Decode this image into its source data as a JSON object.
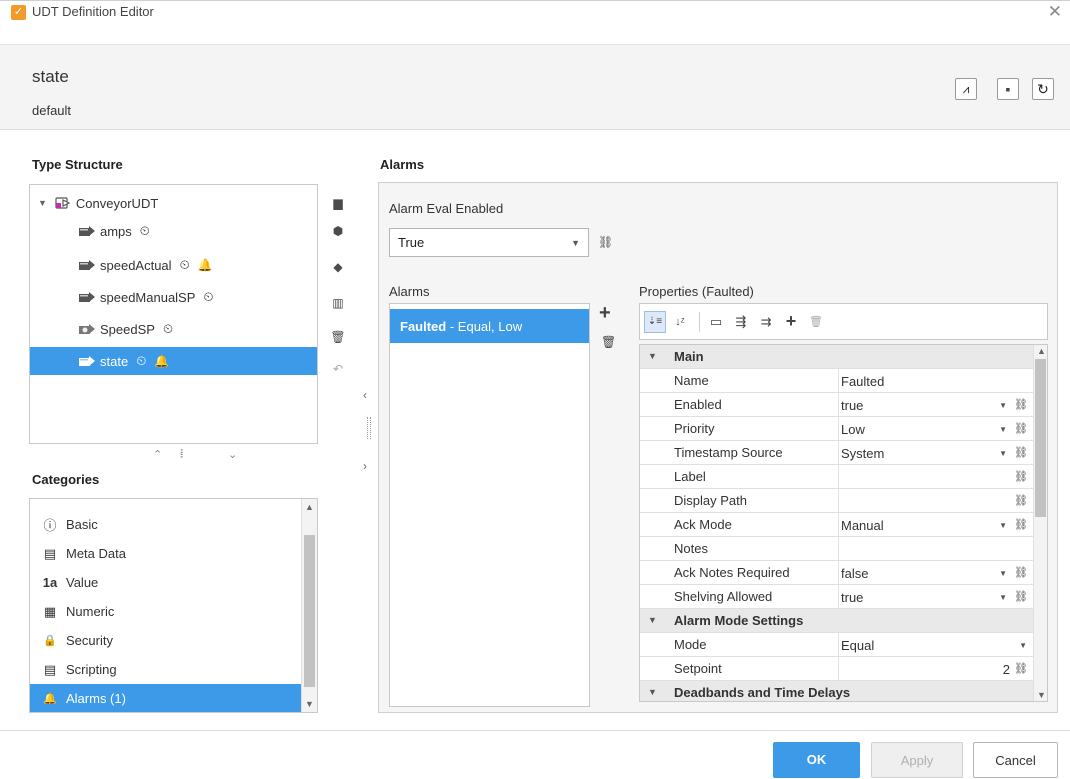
{
  "window": {
    "title": "UDT Definition Editor",
    "close_glyph": "✕",
    "app_icon": "udt-editor-icon",
    "app_icon_glyph": "✓"
  },
  "header": {
    "tag_name": "state",
    "provider": "default",
    "buttons": [
      {
        "name": "trend-button",
        "icon": "trend-icon",
        "glyph": "⩘"
      },
      {
        "name": "documentation-button",
        "icon": "note-icon",
        "glyph": "▪"
      },
      {
        "name": "refresh-button",
        "icon": "refresh-icon",
        "glyph": "↻"
      }
    ]
  },
  "type_structure": {
    "title": "Type Structure",
    "items": [
      {
        "label": "ConveyorUDT",
        "icon": "udt-instance-icon",
        "expander": "▼",
        "clock": false,
        "bell": false,
        "selected": false
      },
      {
        "label": "amps",
        "icon": "tag-icon",
        "clock": true,
        "bell": false,
        "selected": false
      },
      {
        "label": "speedActual",
        "icon": "tag-icon",
        "clock": true,
        "bell": true,
        "selected": false
      },
      {
        "label": "speedManualSP",
        "icon": "tag-icon",
        "clock": true,
        "bell": false,
        "selected": false
      },
      {
        "label": "SpeedSP",
        "icon": "memory-tag-icon",
        "clock": true,
        "bell": false,
        "selected": false
      },
      {
        "label": "state",
        "icon": "tag-icon",
        "clock": true,
        "bell": true,
        "selected": true
      }
    ],
    "clock_glyph": "⏲",
    "bell_glyph": "🔔",
    "tools": [
      {
        "name": "new-folder-button",
        "icon": "folder-icon",
        "glyph": "▆"
      },
      {
        "name": "new-tag-button",
        "icon": "add-tag-icon",
        "glyph": "⬢"
      },
      {
        "name": "new-udt-button",
        "icon": "tag-edit-icon",
        "glyph": "◆"
      },
      {
        "name": "data-types-button",
        "icon": "grid-icon",
        "glyph": "▥"
      },
      {
        "name": "delete-button",
        "icon": "trash-icon",
        "glyph": "🗑"
      },
      {
        "name": "revert-button",
        "icon": "revert-icon",
        "glyph": "↶"
      }
    ],
    "footer": {
      "up": "⌃",
      "grip": "⦙⦙⦙",
      "down": "⌄"
    }
  },
  "splitter": {
    "left": "‹",
    "right": "›"
  },
  "categories": {
    "title": "Categories",
    "items": [
      {
        "label": "Basic",
        "icon": "info-icon",
        "glyph": "ⓘ",
        "selected": false
      },
      {
        "label": "Meta Data",
        "icon": "database-icon",
        "glyph": "▤",
        "selected": false
      },
      {
        "label": "Value",
        "icon": "value-icon",
        "glyph": "1a",
        "selected": false
      },
      {
        "label": "Numeric",
        "icon": "calculator-icon",
        "glyph": "▦",
        "selected": false
      },
      {
        "label": "Security",
        "icon": "lock-icon",
        "glyph": "🔒",
        "selected": false
      },
      {
        "label": "Scripting",
        "icon": "script-icon",
        "glyph": "▤",
        "selected": false
      },
      {
        "label": "Alarms (1)",
        "icon": "bell-icon",
        "glyph": "🔔",
        "selected": true
      }
    ]
  },
  "alarms_section": {
    "title": "Alarms",
    "eval_label": "Alarm Eval Enabled",
    "eval_value": "True",
    "list_label": "Alarms",
    "add_glyph": "+",
    "delete_glyph": "🗑",
    "link_glyph": "⛓",
    "alarm": {
      "name": "Faulted",
      "desc": " - Equal, Low"
    },
    "properties_label": "Properties (Faulted)",
    "toolbar": [
      {
        "name": "sort-categorized-button",
        "icon": "sort-category-icon",
        "glyph": "⇣≡",
        "active": true
      },
      {
        "name": "sort-alpha-button",
        "icon": "sort-alpha-icon",
        "glyph": "↓ᶻ",
        "active": false
      },
      {
        "name": "property-pages-button",
        "icon": "property-pages-icon",
        "glyph": "▭",
        "active": false
      },
      {
        "name": "expand-all-button",
        "icon": "expand-all-icon",
        "glyph": "⇶",
        "active": false
      },
      {
        "name": "collapse-all-button",
        "icon": "collapse-all-icon",
        "glyph": "⇉",
        "active": false
      },
      {
        "name": "add-property-button",
        "icon": "plus-icon",
        "glyph": "+",
        "active": false
      },
      {
        "name": "remove-property-button",
        "icon": "trash-icon",
        "glyph": "🗑",
        "active": false
      }
    ],
    "grid": {
      "groups": [
        {
          "name": "Main",
          "rows": [
            {
              "name": "Name",
              "value": "Faulted",
              "dropdown": false,
              "link": false
            },
            {
              "name": "Enabled",
              "value": "true",
              "dropdown": true,
              "link": true
            },
            {
              "name": "Priority",
              "value": "Low",
              "dropdown": true,
              "link": true
            },
            {
              "name": "Timestamp Source",
              "value": "System",
              "dropdown": true,
              "link": true
            },
            {
              "name": "Label",
              "value": "",
              "dropdown": false,
              "link": true
            },
            {
              "name": "Display Path",
              "value": "",
              "dropdown": false,
              "link": true
            },
            {
              "name": "Ack Mode",
              "value": "Manual",
              "dropdown": true,
              "link": true
            },
            {
              "name": "Notes",
              "value": "",
              "dropdown": false,
              "link": false
            },
            {
              "name": "Ack Notes Required",
              "value": "false",
              "dropdown": true,
              "link": true
            },
            {
              "name": "Shelving Allowed",
              "value": "true",
              "dropdown": true,
              "link": true
            }
          ]
        },
        {
          "name": "Alarm Mode Settings",
          "rows": [
            {
              "name": "Mode",
              "value": "Equal",
              "dropdown": true,
              "link": false
            },
            {
              "name": "Setpoint",
              "value": "2",
              "dropdown": false,
              "link": true,
              "align": "right"
            }
          ]
        },
        {
          "name": "Deadbands and Time Delays",
          "rows": []
        }
      ]
    }
  },
  "buttons": {
    "ok": "OK",
    "apply": "Apply",
    "cancel": "Cancel"
  }
}
